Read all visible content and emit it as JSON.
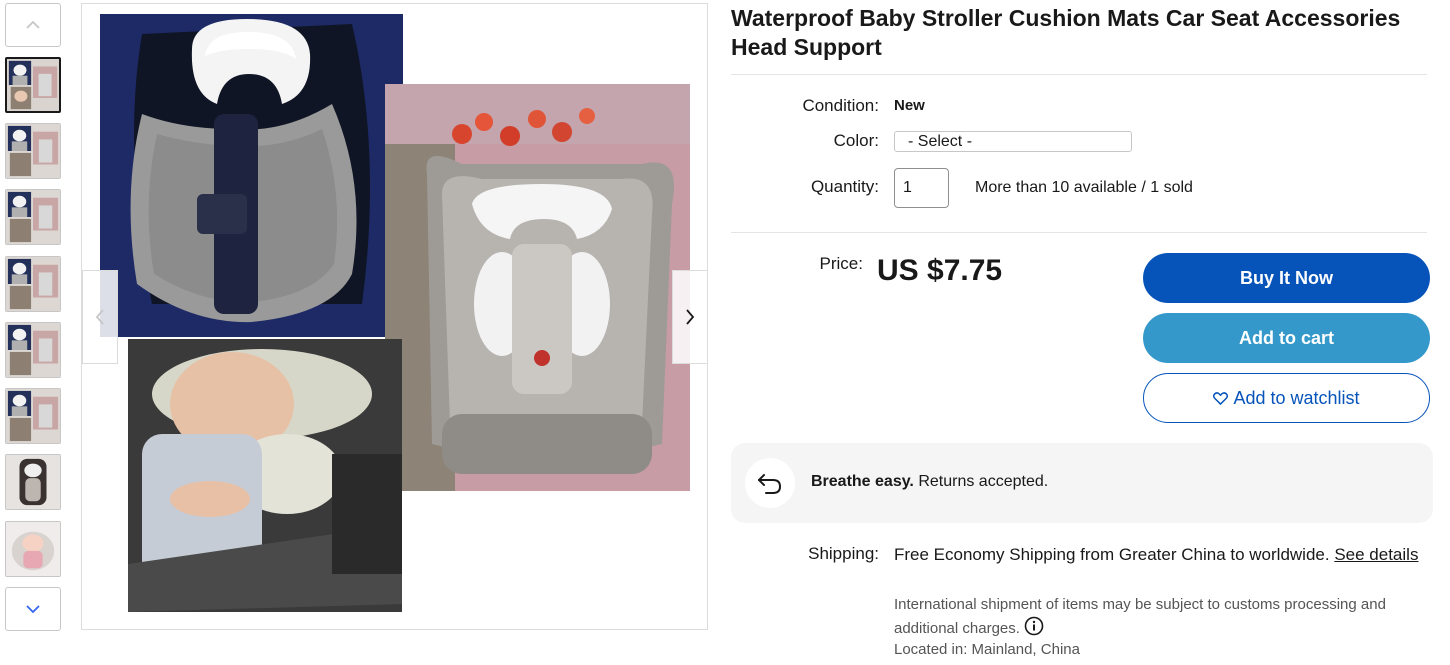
{
  "listing": {
    "title": "Waterproof Baby Stroller Cushion Mats Car Seat Accessories Head Support"
  },
  "gallery": {
    "thumbnail_count": 8,
    "active_thumbnail": 1
  },
  "details": {
    "condition_label": "Condition:",
    "condition_value": "New",
    "color_label": "Color:",
    "color_select_value": "- Select -",
    "quantity_label": "Quantity:",
    "quantity_value": "1",
    "availability": "More than 10 available / 1 sold"
  },
  "pricing": {
    "price_label": "Price:",
    "price_value": "US $7.75"
  },
  "actions": {
    "buy_now": "Buy It Now",
    "add_to_cart": "Add to cart",
    "add_to_watchlist": "Add to watchlist"
  },
  "returns": {
    "emphasis": "Breathe easy.",
    "text": "Returns accepted."
  },
  "shipping": {
    "label": "Shipping:",
    "text": "Free Economy Shipping from Greater China to worldwide.",
    "link": "See details",
    "note": "International shipment of items may be subject to customs processing and additional charges.",
    "location": "Located in: Mainland, China"
  },
  "colors": {
    "buy_button": "#0654ba",
    "cart_button": "#3498ca",
    "watch_text": "#0654ba",
    "returns_bg": "#f5f5f5"
  },
  "icons": {
    "thumb_up": "chevron-up-icon",
    "thumb_down": "chevron-down-icon",
    "prev": "chevron-left-icon",
    "next": "chevron-right-icon",
    "watch": "heart-icon",
    "returns": "return-arrow-icon",
    "info": "info-icon"
  }
}
